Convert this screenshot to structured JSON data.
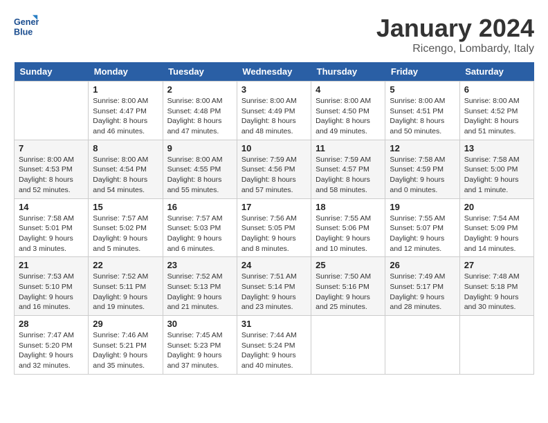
{
  "header": {
    "logo_line1": "General",
    "logo_line2": "Blue",
    "month_title": "January 2024",
    "location": "Ricengo, Lombardy, Italy"
  },
  "days_of_week": [
    "Sunday",
    "Monday",
    "Tuesday",
    "Wednesday",
    "Thursday",
    "Friday",
    "Saturday"
  ],
  "weeks": [
    [
      {
        "day": "",
        "sunrise": "",
        "sunset": "",
        "daylight": ""
      },
      {
        "day": "1",
        "sunrise": "Sunrise: 8:00 AM",
        "sunset": "Sunset: 4:47 PM",
        "daylight": "Daylight: 8 hours and 46 minutes."
      },
      {
        "day": "2",
        "sunrise": "Sunrise: 8:00 AM",
        "sunset": "Sunset: 4:48 PM",
        "daylight": "Daylight: 8 hours and 47 minutes."
      },
      {
        "day": "3",
        "sunrise": "Sunrise: 8:00 AM",
        "sunset": "Sunset: 4:49 PM",
        "daylight": "Daylight: 8 hours and 48 minutes."
      },
      {
        "day": "4",
        "sunrise": "Sunrise: 8:00 AM",
        "sunset": "Sunset: 4:50 PM",
        "daylight": "Daylight: 8 hours and 49 minutes."
      },
      {
        "day": "5",
        "sunrise": "Sunrise: 8:00 AM",
        "sunset": "Sunset: 4:51 PM",
        "daylight": "Daylight: 8 hours and 50 minutes."
      },
      {
        "day": "6",
        "sunrise": "Sunrise: 8:00 AM",
        "sunset": "Sunset: 4:52 PM",
        "daylight": "Daylight: 8 hours and 51 minutes."
      }
    ],
    [
      {
        "day": "7",
        "sunrise": "Sunrise: 8:00 AM",
        "sunset": "Sunset: 4:53 PM",
        "daylight": "Daylight: 8 hours and 52 minutes."
      },
      {
        "day": "8",
        "sunrise": "Sunrise: 8:00 AM",
        "sunset": "Sunset: 4:54 PM",
        "daylight": "Daylight: 8 hours and 54 minutes."
      },
      {
        "day": "9",
        "sunrise": "Sunrise: 8:00 AM",
        "sunset": "Sunset: 4:55 PM",
        "daylight": "Daylight: 8 hours and 55 minutes."
      },
      {
        "day": "10",
        "sunrise": "Sunrise: 7:59 AM",
        "sunset": "Sunset: 4:56 PM",
        "daylight": "Daylight: 8 hours and 57 minutes."
      },
      {
        "day": "11",
        "sunrise": "Sunrise: 7:59 AM",
        "sunset": "Sunset: 4:57 PM",
        "daylight": "Daylight: 8 hours and 58 minutes."
      },
      {
        "day": "12",
        "sunrise": "Sunrise: 7:58 AM",
        "sunset": "Sunset: 4:59 PM",
        "daylight": "Daylight: 9 hours and 0 minutes."
      },
      {
        "day": "13",
        "sunrise": "Sunrise: 7:58 AM",
        "sunset": "Sunset: 5:00 PM",
        "daylight": "Daylight: 9 hours and 1 minute."
      }
    ],
    [
      {
        "day": "14",
        "sunrise": "Sunrise: 7:58 AM",
        "sunset": "Sunset: 5:01 PM",
        "daylight": "Daylight: 9 hours and 3 minutes."
      },
      {
        "day": "15",
        "sunrise": "Sunrise: 7:57 AM",
        "sunset": "Sunset: 5:02 PM",
        "daylight": "Daylight: 9 hours and 5 minutes."
      },
      {
        "day": "16",
        "sunrise": "Sunrise: 7:57 AM",
        "sunset": "Sunset: 5:03 PM",
        "daylight": "Daylight: 9 hours and 6 minutes."
      },
      {
        "day": "17",
        "sunrise": "Sunrise: 7:56 AM",
        "sunset": "Sunset: 5:05 PM",
        "daylight": "Daylight: 9 hours and 8 minutes."
      },
      {
        "day": "18",
        "sunrise": "Sunrise: 7:55 AM",
        "sunset": "Sunset: 5:06 PM",
        "daylight": "Daylight: 9 hours and 10 minutes."
      },
      {
        "day": "19",
        "sunrise": "Sunrise: 7:55 AM",
        "sunset": "Sunset: 5:07 PM",
        "daylight": "Daylight: 9 hours and 12 minutes."
      },
      {
        "day": "20",
        "sunrise": "Sunrise: 7:54 AM",
        "sunset": "Sunset: 5:09 PM",
        "daylight": "Daylight: 9 hours and 14 minutes."
      }
    ],
    [
      {
        "day": "21",
        "sunrise": "Sunrise: 7:53 AM",
        "sunset": "Sunset: 5:10 PM",
        "daylight": "Daylight: 9 hours and 16 minutes."
      },
      {
        "day": "22",
        "sunrise": "Sunrise: 7:52 AM",
        "sunset": "Sunset: 5:11 PM",
        "daylight": "Daylight: 9 hours and 19 minutes."
      },
      {
        "day": "23",
        "sunrise": "Sunrise: 7:52 AM",
        "sunset": "Sunset: 5:13 PM",
        "daylight": "Daylight: 9 hours and 21 minutes."
      },
      {
        "day": "24",
        "sunrise": "Sunrise: 7:51 AM",
        "sunset": "Sunset: 5:14 PM",
        "daylight": "Daylight: 9 hours and 23 minutes."
      },
      {
        "day": "25",
        "sunrise": "Sunrise: 7:50 AM",
        "sunset": "Sunset: 5:16 PM",
        "daylight": "Daylight: 9 hours and 25 minutes."
      },
      {
        "day": "26",
        "sunrise": "Sunrise: 7:49 AM",
        "sunset": "Sunset: 5:17 PM",
        "daylight": "Daylight: 9 hours and 28 minutes."
      },
      {
        "day": "27",
        "sunrise": "Sunrise: 7:48 AM",
        "sunset": "Sunset: 5:18 PM",
        "daylight": "Daylight: 9 hours and 30 minutes."
      }
    ],
    [
      {
        "day": "28",
        "sunrise": "Sunrise: 7:47 AM",
        "sunset": "Sunset: 5:20 PM",
        "daylight": "Daylight: 9 hours and 32 minutes."
      },
      {
        "day": "29",
        "sunrise": "Sunrise: 7:46 AM",
        "sunset": "Sunset: 5:21 PM",
        "daylight": "Daylight: 9 hours and 35 minutes."
      },
      {
        "day": "30",
        "sunrise": "Sunrise: 7:45 AM",
        "sunset": "Sunset: 5:23 PM",
        "daylight": "Daylight: 9 hours and 37 minutes."
      },
      {
        "day": "31",
        "sunrise": "Sunrise: 7:44 AM",
        "sunset": "Sunset: 5:24 PM",
        "daylight": "Daylight: 9 hours and 40 minutes."
      },
      {
        "day": "",
        "sunrise": "",
        "sunset": "",
        "daylight": ""
      },
      {
        "day": "",
        "sunrise": "",
        "sunset": "",
        "daylight": ""
      },
      {
        "day": "",
        "sunrise": "",
        "sunset": "",
        "daylight": ""
      }
    ]
  ]
}
